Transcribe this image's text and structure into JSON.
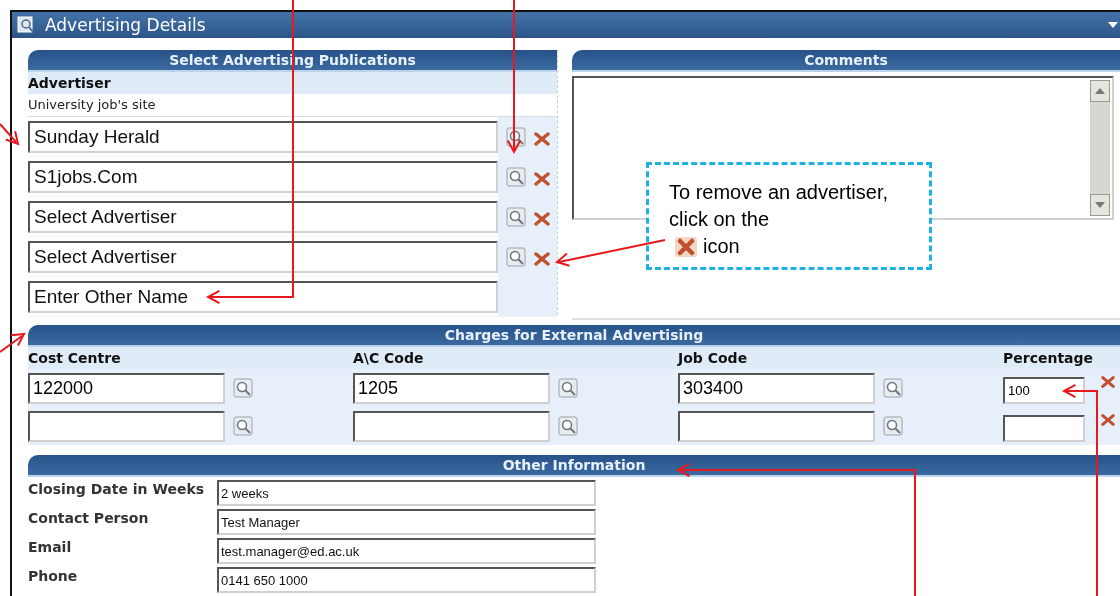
{
  "window": {
    "title": "Advertising Details"
  },
  "publications": {
    "title": "Select Advertising Publications",
    "label": "Advertiser",
    "note": "University job's site",
    "advertisers": [
      {
        "value": "Sunday Herald",
        "kind": "lookup"
      },
      {
        "value": "S1jobs.Com",
        "kind": "lookup"
      },
      {
        "value": "Select Advertiser",
        "kind": "lookup"
      },
      {
        "value": "Select Advertiser",
        "kind": "lookup"
      },
      {
        "value": "Enter Other Name",
        "kind": "other"
      }
    ]
  },
  "comments": {
    "title": "Comments"
  },
  "charges": {
    "title": "Charges for External Advertising",
    "columns": [
      "Cost Centre",
      "A\\C Code",
      "Job Code",
      "Percentage"
    ],
    "rows": [
      [
        "122000",
        "1205",
        "303400",
        "100"
      ],
      [
        "",
        "",
        "",
        ""
      ]
    ]
  },
  "other_information": {
    "title": "Other Information",
    "fields": [
      {
        "label": "Closing Date in Weeks",
        "value": "2 weeks"
      },
      {
        "label": "Contact Person",
        "value": "Test Manager"
      },
      {
        "label": "Email",
        "value": "test.manager@ed.ac.uk"
      },
      {
        "label": "Phone",
        "value": "0141 650 1000"
      }
    ]
  },
  "callout": {
    "text": "To remove an advertiser, click on the",
    "suffix": "icon"
  }
}
